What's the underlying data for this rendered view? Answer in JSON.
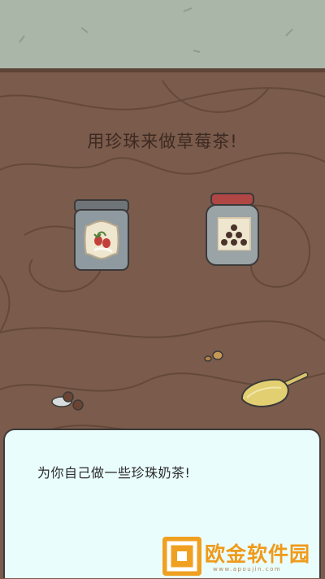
{
  "scene": {
    "instruction": "用珍珠来做草莓茶!",
    "items": {
      "tea_jar": "strawberry-tea-jar",
      "pearl_jar": "tapioca-pearl-jar",
      "scoop": "scoop",
      "pebbles": "pebbles",
      "bone": "bone"
    }
  },
  "dialog": {
    "text": "为你自己做一些珍珠奶茶!"
  },
  "watermark": {
    "title": "欧金软件园",
    "url": "www.apoujin.com"
  },
  "colors": {
    "wall": "#a9b6a8",
    "table": "#7b5b4b",
    "dialog_bg": "#eafdfd",
    "watermark": "#f09a1a"
  }
}
